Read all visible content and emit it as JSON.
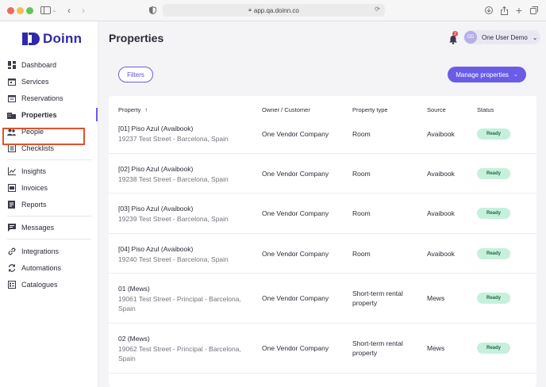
{
  "browser": {
    "url": "app.qa.doinn.co"
  },
  "brand": {
    "name": "Doinn",
    "color": "#2f2aa8",
    "accent": "#6b5ce7"
  },
  "sidebar": {
    "items": [
      {
        "label": "Dashboard",
        "icon": "grid-icon"
      },
      {
        "label": "Services",
        "icon": "calendar-icon"
      },
      {
        "label": "Reservations",
        "icon": "calendar-icon"
      },
      {
        "label": "Properties",
        "icon": "building-icon",
        "active": true
      },
      {
        "label": "People",
        "icon": "people-icon"
      },
      {
        "label": "Checklists",
        "icon": "checklist-icon"
      },
      {
        "label": "Insights",
        "icon": "chart-icon"
      },
      {
        "label": "Invoices",
        "icon": "invoice-icon"
      },
      {
        "label": "Reports",
        "icon": "report-icon"
      },
      {
        "label": "Messages",
        "icon": "message-icon"
      },
      {
        "label": "Integrations",
        "icon": "link-icon"
      },
      {
        "label": "Automations",
        "icon": "refresh-icon"
      },
      {
        "label": "Catalogues",
        "icon": "catalogue-icon"
      }
    ]
  },
  "header": {
    "title": "Properties",
    "notification_count": "2",
    "user": {
      "initials": "OD",
      "name": "One User Demo"
    }
  },
  "toolbar": {
    "filters_label": "Filters",
    "manage_label": "Manage properties"
  },
  "table": {
    "columns": [
      "Property",
      "Owner / Customer",
      "Property type",
      "Source",
      "Status"
    ],
    "rows": [
      {
        "name": "[01] Piso Azul (Avaibook)",
        "address": "19237 Test Street - Barcelona, Spain",
        "owner": "One Vendor Company",
        "type": "Room",
        "source": "Avaibook",
        "status": "Ready"
      },
      {
        "name": "[02] Piso Azul (Avaibook)",
        "address": "19238 Test Street - Barcelona, Spain",
        "owner": "One Vendor Company",
        "type": "Room",
        "source": "Avaibook",
        "status": "Ready"
      },
      {
        "name": "[03] Piso Azul (Avaibook)",
        "address": "19239 Test Street - Barcelona, Spain",
        "owner": "One Vendor Company",
        "type": "Room",
        "source": "Avaibook",
        "status": "Ready"
      },
      {
        "name": "[04] Piso Azul (Avaibook)",
        "address": "19240 Test Street - Barcelona, Spain",
        "owner": "One Vendor Company",
        "type": "Room",
        "source": "Avaibook",
        "status": "Ready"
      },
      {
        "name": "01 (Mews)",
        "address_l1": "19061 Test Street - Principal - Barcelona,",
        "address_l2": "Spain",
        "owner": "One Vendor Company",
        "type_l1": "Short-term rental",
        "type_l2": "property",
        "source": "Mews",
        "status": "Ready"
      },
      {
        "name": "02 (Mews)",
        "address_l1": "19062 Test Street - Principal - Barcelona,",
        "address_l2": "Spain",
        "owner": "One Vendor Company",
        "type_l1": "Short-term rental",
        "type_l2": "property",
        "source": "Mews",
        "status": "Ready"
      }
    ]
  }
}
